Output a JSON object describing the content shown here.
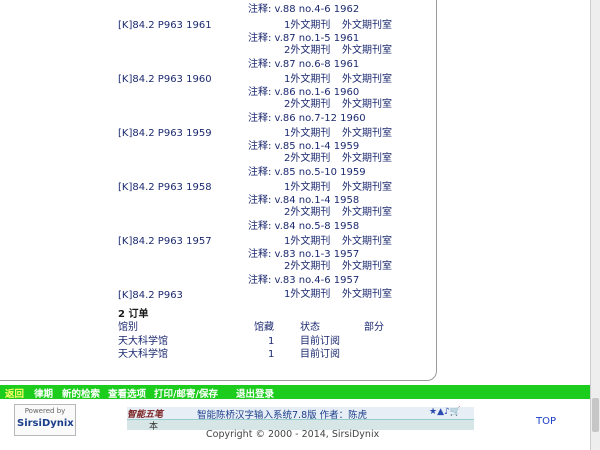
{
  "top_note": "注释: v.88 no.4-6 1962",
  "holdings": [
    {
      "callnumber": "[K]84.2 P963 1961",
      "copy1": "1外文期刊",
      "loc1": "外文期刊室",
      "note1": "注释: v.87 no.1-5 1961",
      "copy2": "2外文期刊",
      "loc2": "外文期刊室",
      "note2": "注释: v.87 no.6-8 1961"
    },
    {
      "callnumber": "[K]84.2 P963 1960",
      "copy1": "1外文期刊",
      "loc1": "外文期刊室",
      "note1": "注释: v.86 no.1-6 1960",
      "copy2": "2外文期刊",
      "loc2": "外文期刊室",
      "note2": "注释: v.86 no.7-12 1960"
    },
    {
      "callnumber": "[K]84.2 P963 1959",
      "copy1": "1外文期刊",
      "loc1": "外文期刊室",
      "note1": "注释: v.85 no.1-4 1959",
      "copy2": "2外文期刊",
      "loc2": "外文期刊室",
      "note2": "注释: v.85 no.5-10 1959"
    },
    {
      "callnumber": "[K]84.2 P963 1958",
      "copy1": "1外文期刊",
      "loc1": "外文期刊室",
      "note1": "注释: v.84 no.1-4 1958",
      "copy2": "2外文期刊",
      "loc2": "外文期刊室",
      "note2": "注释: v.84 no.5-8 1958"
    },
    {
      "callnumber": "[K]84.2 P963 1957",
      "copy1": "1外文期刊",
      "loc1": "外文期刊室",
      "note1": "注释: v.83 no.1-3 1957",
      "copy2": "2外文期刊",
      "loc2": "外文期刊室",
      "note2": "注释: v.83 no.4-6 1957"
    }
  ],
  "last_holding": {
    "callnumber": "[K]84.2 P963",
    "copy1": "1外文期刊",
    "loc1": "外文期刊室"
  },
  "orders": {
    "title": "2 订单",
    "headers": [
      "馆别",
      "馆藏",
      "状态",
      "部分"
    ],
    "rows": [
      {
        "library": "天大科学馆",
        "copies": "1",
        "status": "目前订阅"
      },
      {
        "library": "天大科学馆",
        "copies": "1",
        "status": "目前订阅"
      }
    ]
  },
  "nav": [
    "返回",
    "律期",
    "新的检索",
    "查看选项",
    "打印/邮寄/保存",
    "退出登录"
  ],
  "footer": {
    "powered_by": "Powered by",
    "brand": "SirsiDynix",
    "ime_brand": "智能五笔",
    "ime_text": "智能陈桥汉字输入系统7.8版   作者：陈虎",
    "ime_status": "本",
    "copyright": "Copyright © 2000 - 2014, SirsiDynix",
    "top_link": "TOP"
  }
}
